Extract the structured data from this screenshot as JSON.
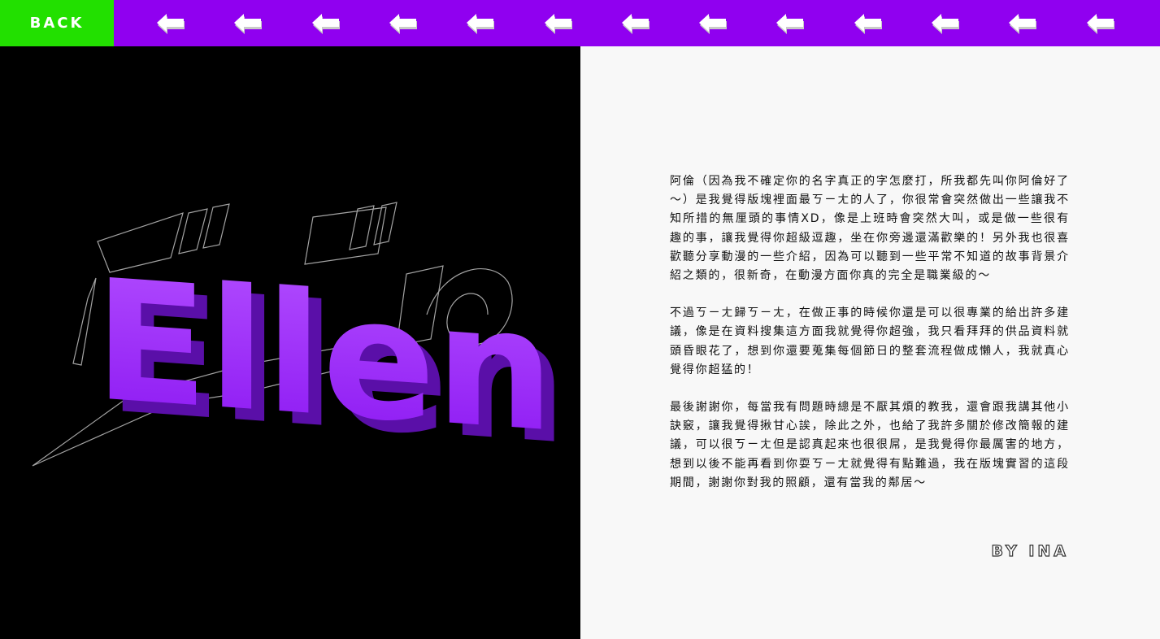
{
  "nav": {
    "back_label": "BACK",
    "arrow_icon": "left-arrow-icon",
    "arrow_count": 13,
    "colors": {
      "bar": "#9000f0",
      "back": "#22e000",
      "arrow": "#ffffff"
    }
  },
  "hero": {
    "name": "Ellen",
    "outline_text": "ジョジョの",
    "colors": {
      "fill": "#9a2cff",
      "side": "#5a0fa8",
      "outline": "#9a9a9a",
      "background": "#000000"
    }
  },
  "letter": {
    "paragraphs": [
      "阿倫（因為我不確定你的名字真正的字怎麼打，所我都先叫你阿倫好了～）是我覺得版塊裡面最ㄎㄧㄤ的人了，你很常會突然做出一些讓我不知所措的無厘頭的事情XD，像是上班時會突然大叫，或是做一些很有趣的事，讓我覺得你超級逗趣，坐在你旁邊還滿歡樂的！另外我也很喜歡聽分享動漫的一些介紹，因為可以聽到一些平常不知道的故事背景介紹之類的，很新奇，在動漫方面你真的完全是職業級的～",
      "不過ㄎㄧㄤ歸ㄎㄧㄤ，在做正事的時候你還是可以很專業的給出許多建議，像是在資料搜集這方面我就覺得你超強，我只看拜拜的供品資料就頭昏眼花了，想到你還要蒐集每個節日的整套流程做成懶人，我就真心覺得你超猛的！",
      "最後謝謝你，每當我有問題時總是不厭其煩的教我，還會跟我講其他小訣竅，讓我覺得揪甘心誒，除此之外，也給了我許多關於修改簡報的建議，可以很ㄎㄧㄤ但是認真起來也很很屌，是我覺得你最厲害的地方，想到以後不能再看到你耍ㄎㄧㄤ就覺得有點難過，我在版塊實習的這段期間，謝謝你對我的照顧，還有當我的鄰居～"
    ],
    "signature": "BY INA"
  }
}
